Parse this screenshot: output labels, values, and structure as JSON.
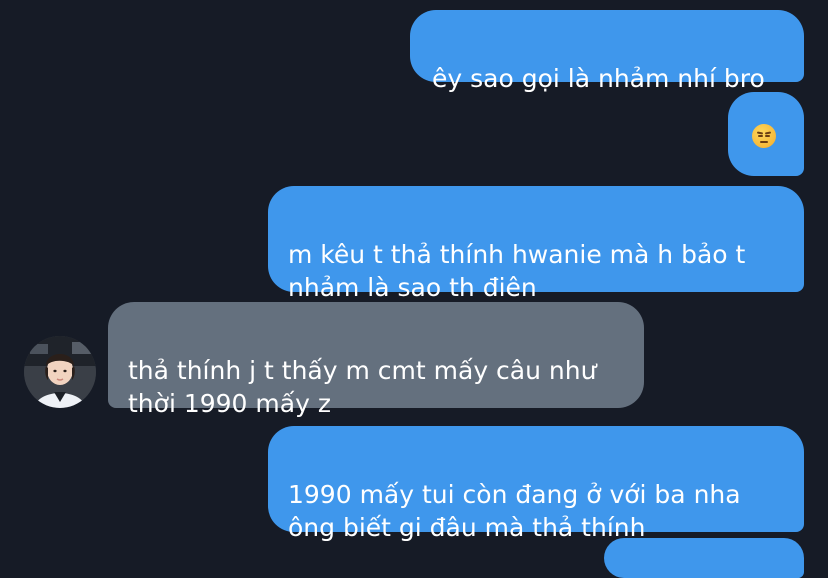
{
  "conversation": {
    "messages": [
      {
        "direction": "sent",
        "text": "êy sao gọi là nhảm nhí bro"
      },
      {
        "direction": "sent",
        "text": "",
        "emoji": "unamused-face"
      },
      {
        "direction": "sent",
        "text": "m kêu t thả thính hwanie mà h bảo t\nnhảm là sao th điên"
      },
      {
        "direction": "received",
        "text": "thả thính j t thấy m cmt mấy câu như\nthời 1990 mấy z"
      },
      {
        "direction": "sent",
        "text": "1990 mấy tui còn đang ở với ba nha\nông biết gi đâu mà thả thính"
      }
    ]
  },
  "theme": {
    "background": "#161b26",
    "sent_bubble": "#3f97ec",
    "received_bubble": "#64707e",
    "text": "#ffffff"
  }
}
